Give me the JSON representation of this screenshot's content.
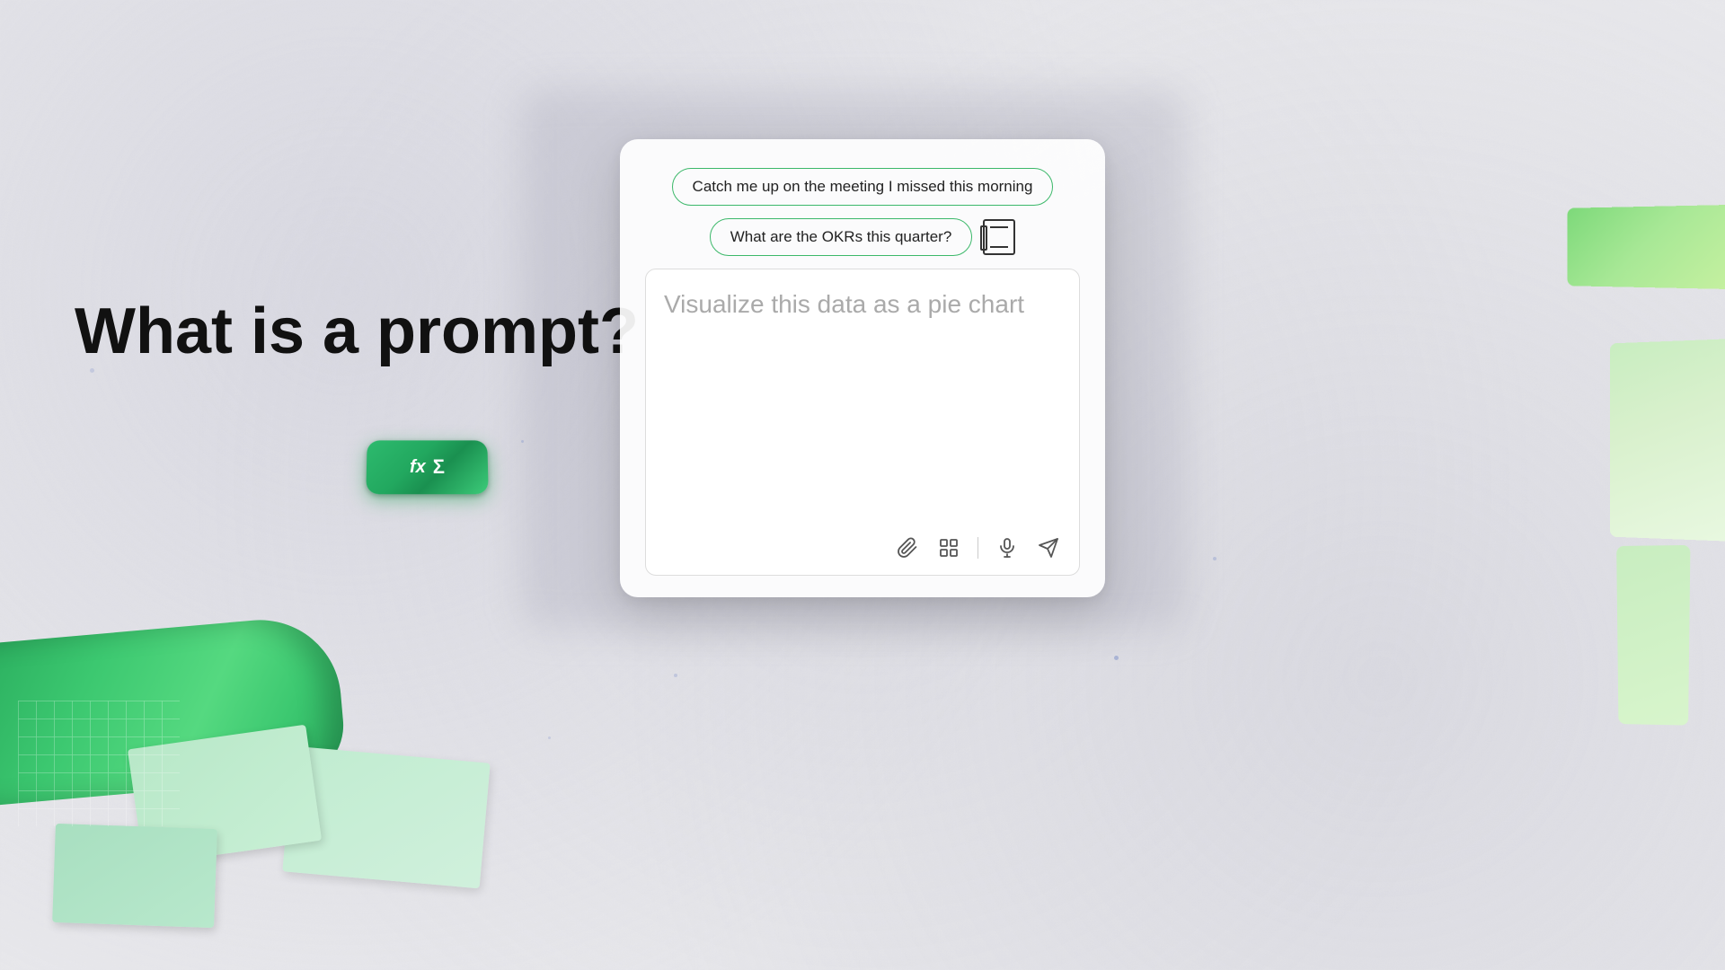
{
  "background": {
    "color": "#e8e8ec"
  },
  "heading": {
    "line1": "What is a prompt?"
  },
  "formula_button": {
    "fx_label": "fx",
    "sigma_label": "Σ"
  },
  "chips": {
    "chip1": "Catch me up on the meeting I missed this morning",
    "chip2": "What are the OKRs this quarter?"
  },
  "input": {
    "placeholder": "Visualize this data as a pie chart"
  },
  "toolbar_icons": {
    "attach": "attach-icon",
    "plugin": "plugin-icon",
    "mic": "mic-icon",
    "send": "send-icon"
  }
}
